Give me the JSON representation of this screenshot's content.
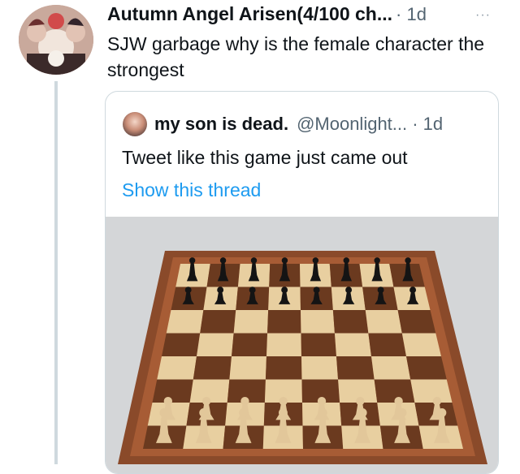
{
  "tweet": {
    "author_name": "Autumn Angel Arisen(4/100 ch...",
    "time": "· 1d",
    "more_label": "···",
    "text": "SJW garbage why is the female character the strongest"
  },
  "quote": {
    "author_name": "my son is dead.",
    "handle": "@Moonlight... · 1d",
    "text": "Tweet like this game just came out",
    "link": "Show this thread"
  },
  "image": {
    "subject": "chessboard",
    "colors": {
      "frame": "#8a4a2a",
      "dark_square": "#6b3a1f",
      "light_square": "#e8cfa0",
      "black_piece": "#141414",
      "white_piece": "#e2c79a"
    }
  }
}
